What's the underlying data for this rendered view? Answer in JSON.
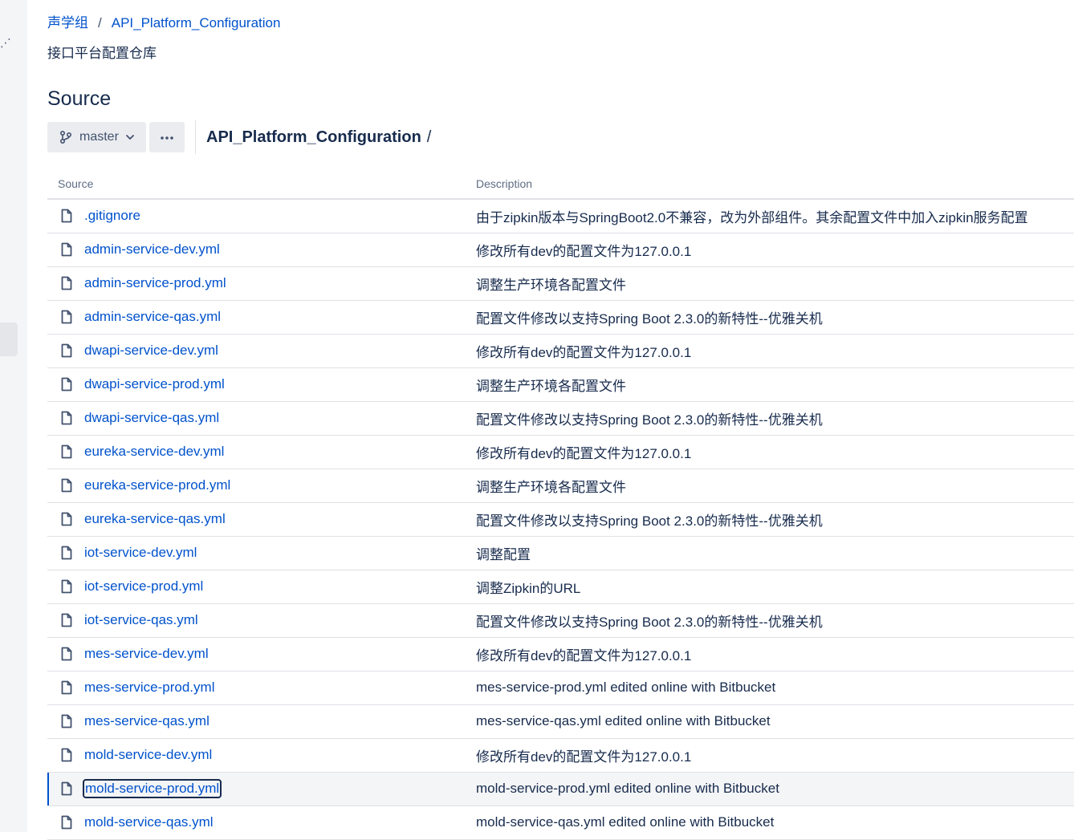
{
  "sidebar": {
    "dots": "⋰"
  },
  "breadcrumb": {
    "project": "声学组",
    "separator": "/",
    "repo": "API_Platform_Configuration"
  },
  "repo_description": "接口平台配置仓库",
  "page_title": "Source",
  "toolbar": {
    "branch": "master",
    "more": "···",
    "path": "API_Platform_Configuration",
    "path_separator": "/"
  },
  "table": {
    "headers": {
      "source": "Source",
      "description": "Description"
    },
    "rows": [
      {
        "name": ".gitignore",
        "description": "由于zipkin版本与SpringBoot2.0不兼容，改为外部组件。其余配置文件中加入zipkin服务配置"
      },
      {
        "name": "admin-service-dev.yml",
        "description": "修改所有dev的配置文件为127.0.0.1"
      },
      {
        "name": "admin-service-prod.yml",
        "description": "调整生产环境各配置文件"
      },
      {
        "name": "admin-service-qas.yml",
        "description": "配置文件修改以支持Spring Boot 2.3.0的新特性--优雅关机"
      },
      {
        "name": "dwapi-service-dev.yml",
        "description": "修改所有dev的配置文件为127.0.0.1"
      },
      {
        "name": "dwapi-service-prod.yml",
        "description": "调整生产环境各配置文件"
      },
      {
        "name": "dwapi-service-qas.yml",
        "description": "配置文件修改以支持Spring Boot 2.3.0的新特性--优雅关机"
      },
      {
        "name": "eureka-service-dev.yml",
        "description": "修改所有dev的配置文件为127.0.0.1"
      },
      {
        "name": "eureka-service-prod.yml",
        "description": "调整生产环境各配置文件"
      },
      {
        "name": "eureka-service-qas.yml",
        "description": "配置文件修改以支持Spring Boot 2.3.0的新特性--优雅关机"
      },
      {
        "name": "iot-service-dev.yml",
        "description": "调整配置"
      },
      {
        "name": "iot-service-prod.yml",
        "description": "调整Zipkin的URL"
      },
      {
        "name": "iot-service-qas.yml",
        "description": "配置文件修改以支持Spring Boot 2.3.0的新特性--优雅关机"
      },
      {
        "name": "mes-service-dev.yml",
        "description": "修改所有dev的配置文件为127.0.0.1"
      },
      {
        "name": "mes-service-prod.yml",
        "description": "mes-service-prod.yml edited online with Bitbucket"
      },
      {
        "name": "mes-service-qas.yml",
        "description": "mes-service-qas.yml edited online with Bitbucket"
      },
      {
        "name": "mold-service-dev.yml",
        "description": "修改所有dev的配置文件为127.0.0.1"
      },
      {
        "name": "mold-service-prod.yml",
        "description": "mold-service-prod.yml edited online with Bitbucket",
        "selected": true
      },
      {
        "name": "mold-service-qas.yml",
        "description": "mold-service-qas.yml edited online with Bitbucket"
      }
    ]
  },
  "colors": {
    "link": "#0052cc",
    "text": "#172b4d",
    "muted": "#5e6c84",
    "border": "#dfe1e6",
    "button_bg": "#ebecf0",
    "selected_row": "#f4f5f7"
  },
  "icons": {
    "branch": "branch-icon",
    "chevron": "chevron-down-icon",
    "more": "more-icon",
    "file": "file-icon"
  }
}
